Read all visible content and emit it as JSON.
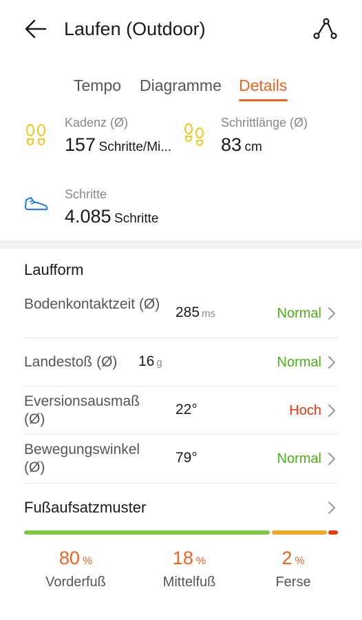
{
  "header": {
    "title": "Laufen (Outdoor)"
  },
  "tabs": [
    {
      "label": "Tempo"
    },
    {
      "label": "Diagramme"
    },
    {
      "label": "Details"
    }
  ],
  "stats": {
    "cadence": {
      "label": "Kadenz (Ø)",
      "value": "157",
      "unit": "Schritte/Mi..."
    },
    "stride": {
      "label": "Schrittlänge (Ø)",
      "value": "83",
      "unit": "cm"
    },
    "steps": {
      "label": "Schritte",
      "value": "4.085",
      "unit": "Schritte"
    }
  },
  "running_form": {
    "title": "Laufform",
    "rows": [
      {
        "label": "Bodenkontaktzeit (Ø)",
        "value": "285",
        "unit": "ms",
        "status": "Normal",
        "status_color": "#4caf1a"
      },
      {
        "label": "Landestoß (Ø)",
        "value": "16",
        "unit": "g",
        "status": "Normal",
        "status_color": "#4caf1a"
      },
      {
        "label": "Eversionsausmaß (Ø)",
        "value": "22°",
        "unit": "",
        "status": "Hoch",
        "status_color": "#f0320f"
      },
      {
        "label": "Bewegungswinkel (Ø)",
        "value": "79°",
        "unit": "",
        "status": "Normal",
        "status_color": "#4caf1a"
      }
    ]
  },
  "foot_strike": {
    "title": "Fußaufsatzmuster",
    "segments": [
      {
        "name": "Vorderfuß",
        "percent": "80",
        "symbol": "%",
        "color": "#7ac943"
      },
      {
        "name": "Mittelfuß",
        "percent": "18",
        "symbol": "%",
        "color": "#f5a623"
      },
      {
        "name": "Ferse",
        "percent": "2",
        "symbol": "%",
        "color": "#f0320f"
      }
    ]
  },
  "colors": {
    "accent": "#f2621f",
    "footprint_icon": "#f5c518",
    "shoe_icon": "#2f7fe0"
  },
  "icons": [
    "arrow-left-icon",
    "route-icon",
    "footprints-icon",
    "shoe-icon",
    "chevron-right-icon"
  ]
}
